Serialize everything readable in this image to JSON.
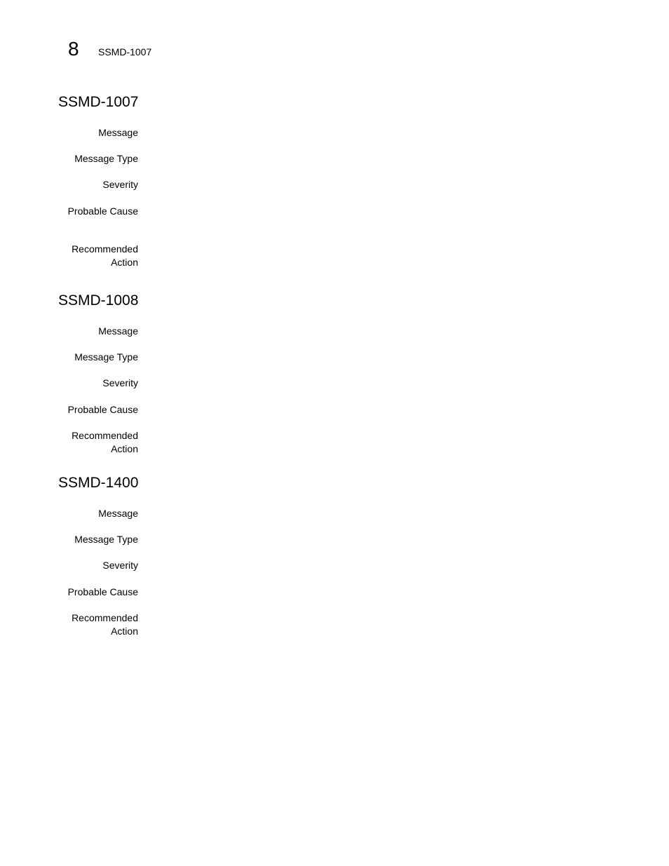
{
  "header": {
    "chapter_number": "8",
    "running_title": "SSMD-1007"
  },
  "sections": [
    {
      "title": "SSMD-1007",
      "labels": {
        "message": "Message",
        "message_type": "Message Type",
        "severity": "Severity",
        "probable_cause": "Probable Cause",
        "recommended_action_1": "Recommended",
        "recommended_action_2": "Action"
      }
    },
    {
      "title": "SSMD-1008",
      "labels": {
        "message": "Message",
        "message_type": "Message Type",
        "severity": "Severity",
        "probable_cause": "Probable Cause",
        "recommended_action_1": "Recommended",
        "recommended_action_2": "Action"
      }
    },
    {
      "title": "SSMD-1400",
      "labels": {
        "message": "Message",
        "message_type": "Message Type",
        "severity": "Severity",
        "probable_cause": "Probable Cause",
        "recommended_action_1": "Recommended",
        "recommended_action_2": "Action"
      }
    }
  ]
}
